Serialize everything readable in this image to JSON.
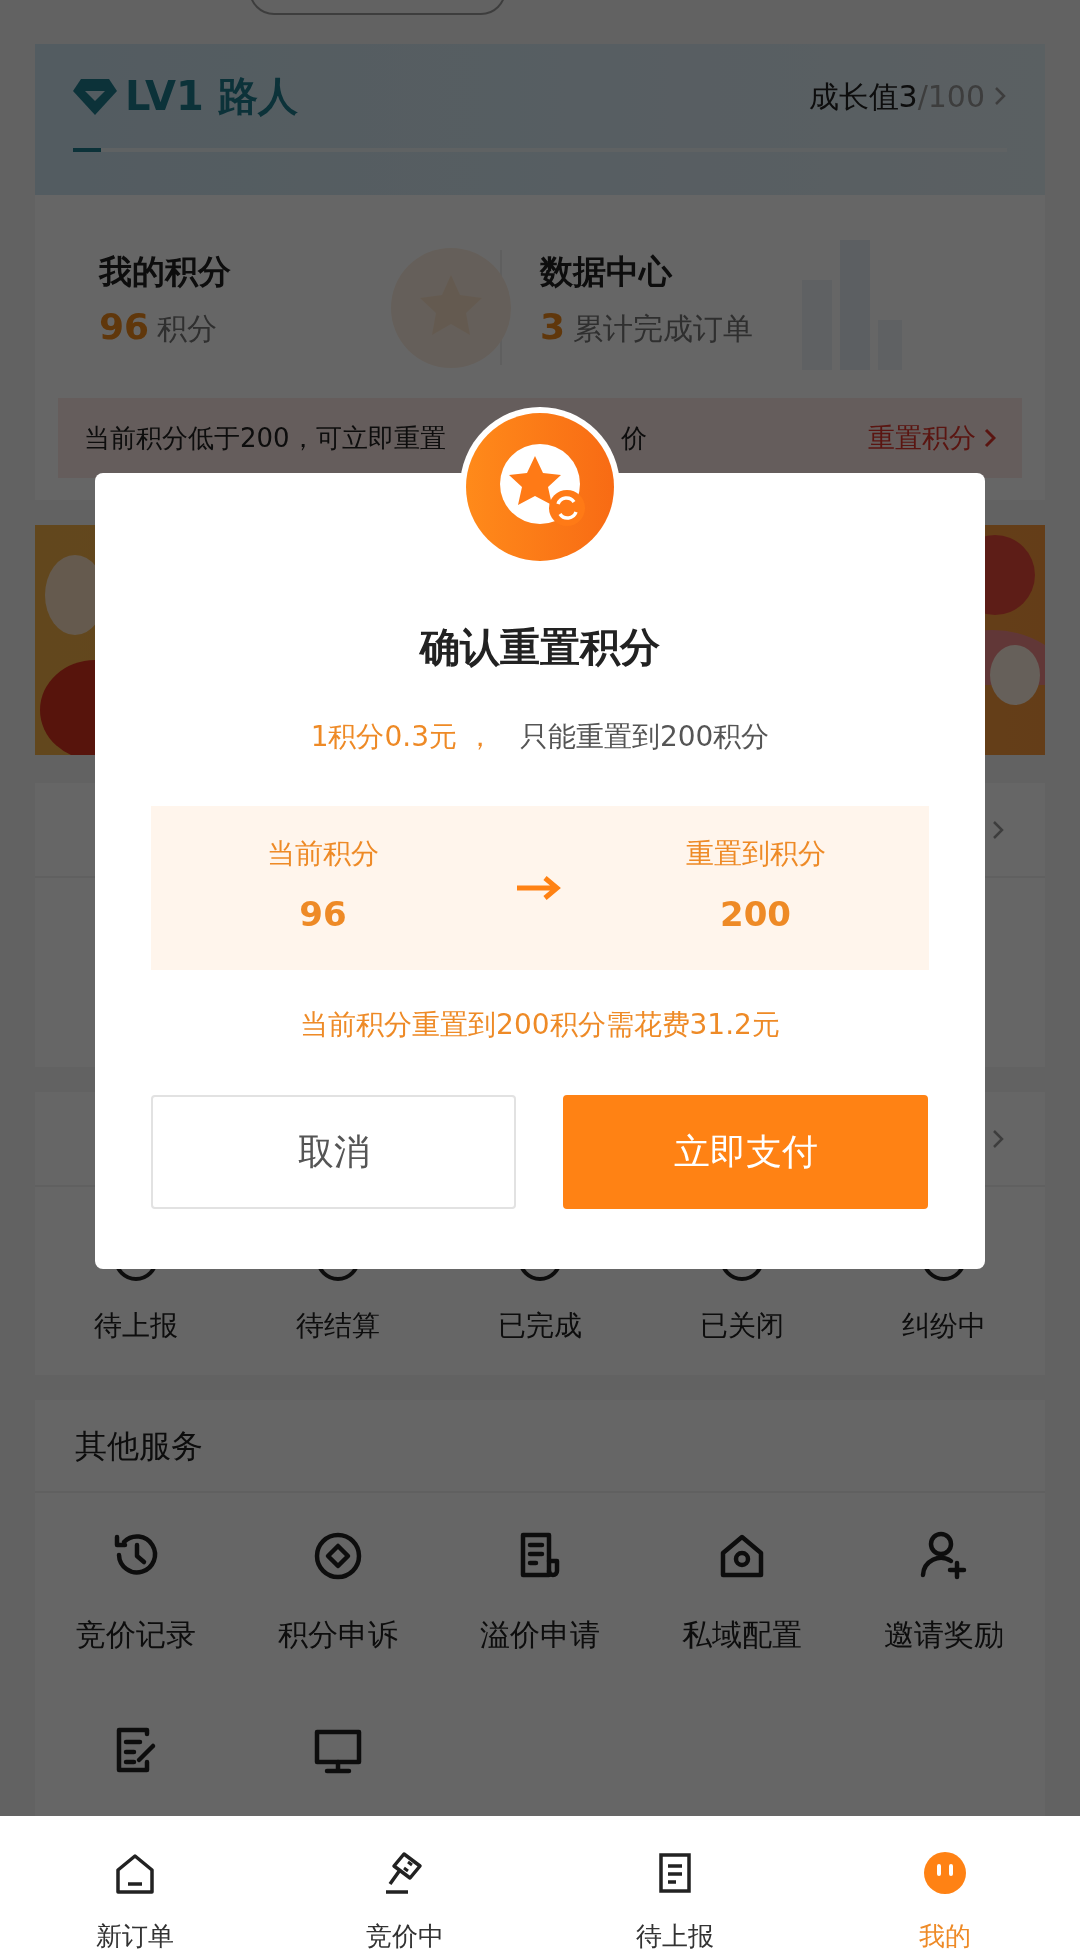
{
  "level_card": {
    "title": "LV1 路人",
    "growth": "成长值3",
    "growth_total": "/100",
    "level": 0.03
  },
  "points": {
    "title": "我的积分",
    "value": "96",
    "unit": "积分"
  },
  "data_center": {
    "title": "数据中心",
    "value": "3",
    "unit": "累计完成订单"
  },
  "notice": {
    "text": "当前积分低于200，可立即重置",
    "text_tail": "价",
    "action": "重置积分"
  },
  "order_statuses": [
    "待上报",
    "待结算",
    "已完成",
    "已关闭",
    "纠纷中"
  ],
  "services": {
    "title": "其他服务",
    "labels": [
      "竞价记录",
      "积分申诉",
      "溢价申请",
      "私域配置",
      "邀请奖励"
    ]
  },
  "dialog": {
    "title": "确认重置积分",
    "rate": "1积分0.3元 ，",
    "rule": "只能重置到200积分",
    "from_label": "当前积分",
    "from_value": "96",
    "to_label": "重置到积分",
    "to_value": "200",
    "cost": "当前积分重置到200积分需花费31.2元",
    "buttons": [
      {
        "label": "取消",
        "kind": "secondary"
      },
      {
        "label": "立即支付",
        "kind": "primary"
      }
    ]
  },
  "tabbar": [
    {
      "label": "新订单",
      "selected": false
    },
    {
      "label": "竞价中",
      "selected": false
    },
    {
      "label": "待上报",
      "selected": false
    },
    {
      "label": "我的",
      "selected": true
    }
  ]
}
